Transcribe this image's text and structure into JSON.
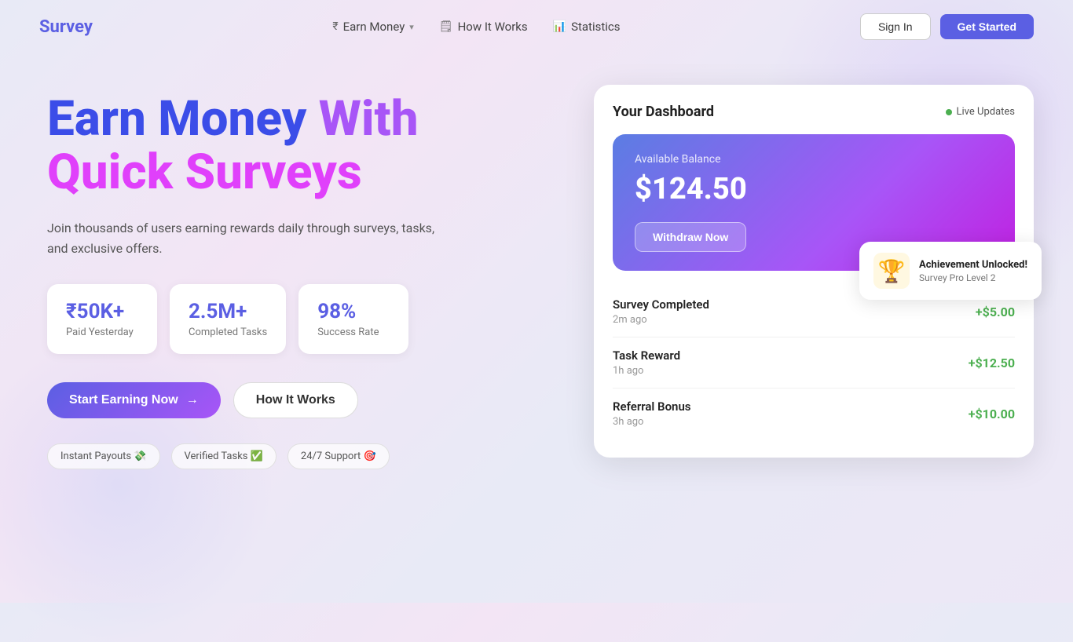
{
  "nav": {
    "logo": "Survey",
    "links": [
      {
        "id": "earn-money",
        "label": "Earn Money",
        "icon": "₹",
        "hasChevron": true
      },
      {
        "id": "how-it-works",
        "label": "How It Works",
        "icon": "🗒"
      },
      {
        "id": "statistics",
        "label": "Statistics",
        "icon": "📊"
      }
    ],
    "signin_label": "Sign In",
    "getstarted_label": "Get Started"
  },
  "hero": {
    "title_line1_blue": "Earn Money",
    "title_line1_purple": "With",
    "title_line2_pink": "Quick Surveys",
    "subtitle": "Join thousands of users earning rewards daily through surveys, tasks, and exclusive offers.",
    "stats": [
      {
        "value": "₹50K+",
        "label": "Paid Yesterday"
      },
      {
        "value": "2.5M+",
        "label": "Completed Tasks"
      },
      {
        "value": "98%",
        "label": "Success Rate"
      }
    ],
    "cta_primary": "Start Earning Now",
    "cta_secondary": "How It Works",
    "badges": [
      {
        "id": "instant-payouts",
        "text": "Instant Payouts 💸"
      },
      {
        "id": "verified-tasks",
        "text": "Verified Tasks ✅"
      },
      {
        "id": "support",
        "text": "24/7 Support 🎯"
      }
    ]
  },
  "dashboard": {
    "title": "Your Dashboard",
    "live_label": "Live Updates",
    "balance_label": "Available Balance",
    "balance_amount": "$124.50",
    "withdraw_btn": "Withdraw Now",
    "achievement": {
      "title": "Achievement Unlocked!",
      "subtitle": "Survey Pro Level 2",
      "icon": "🏆"
    },
    "transactions": [
      {
        "name": "Survey Completed",
        "time": "2m ago",
        "amount": "+$5.00"
      },
      {
        "name": "Task Reward",
        "time": "1h ago",
        "amount": "+$12.50"
      },
      {
        "name": "Referral Bonus",
        "time": "3h ago",
        "amount": "+$10.00"
      }
    ]
  }
}
